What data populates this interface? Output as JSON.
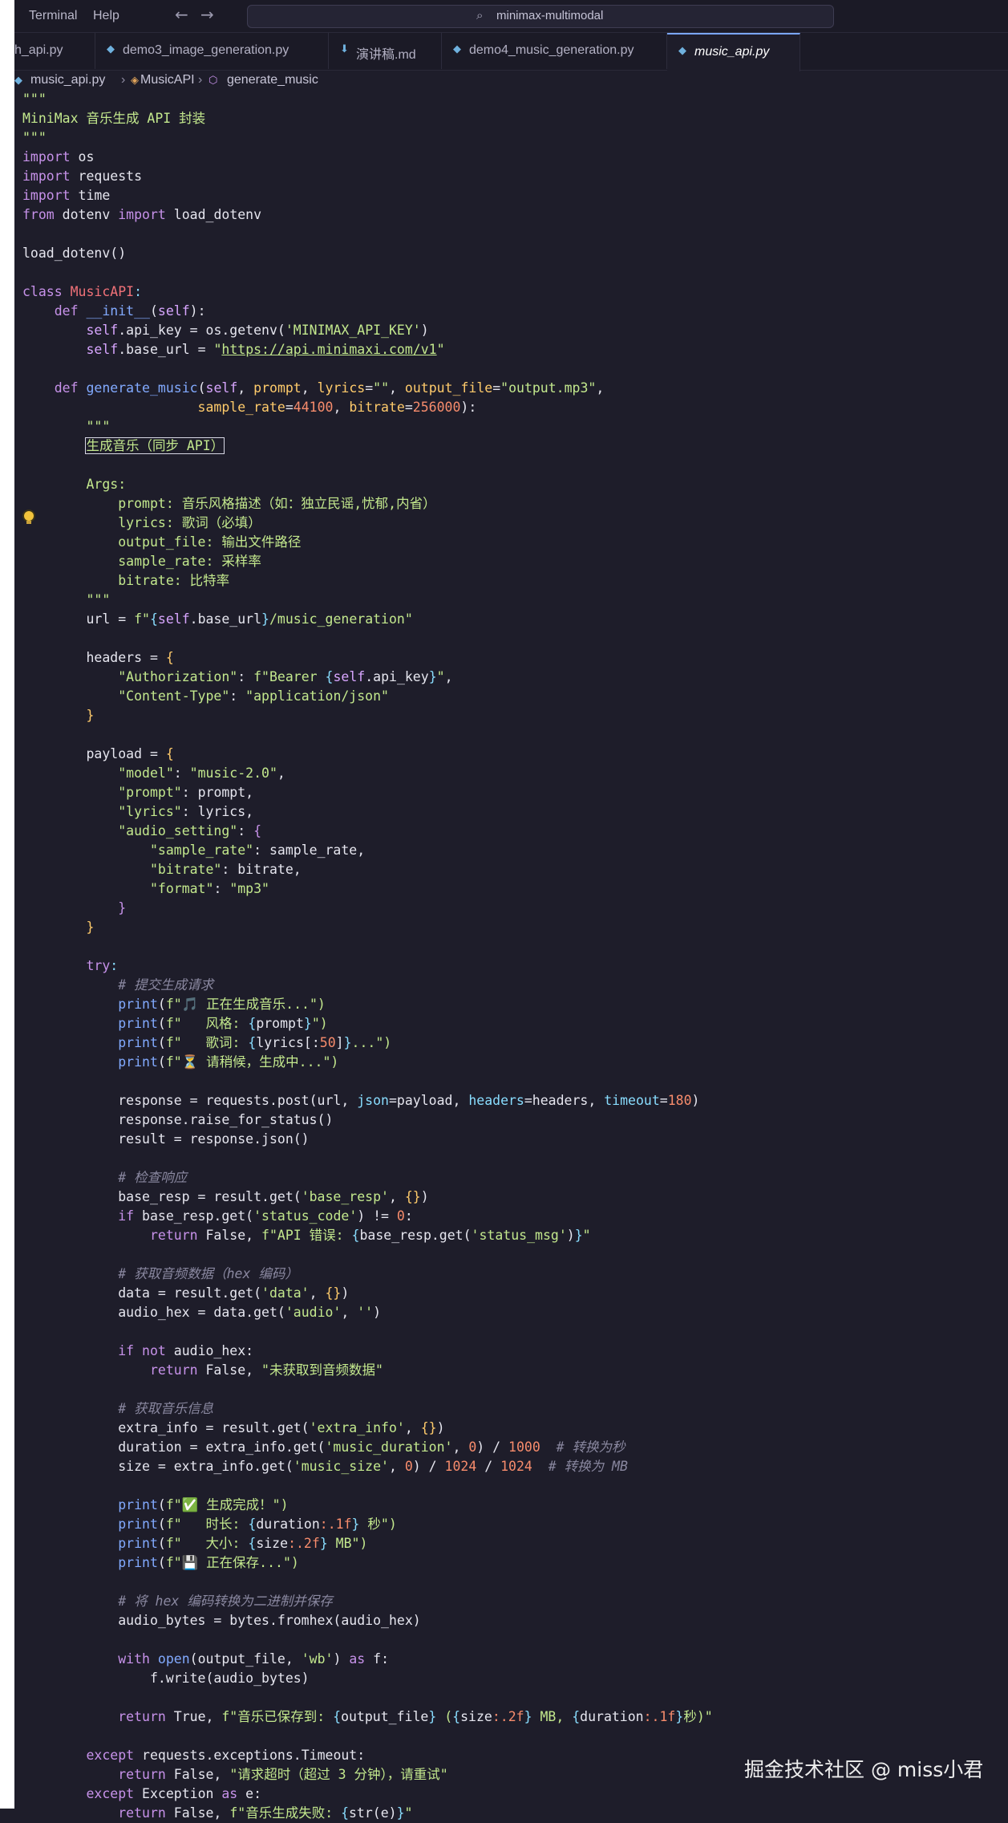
{
  "menu": {
    "terminal": "Terminal",
    "help": "Help",
    "back_icon": "←",
    "forward_icon": "→"
  },
  "search": {
    "icon": "⌕",
    "text": "minimax-multimodal"
  },
  "tabs": [
    {
      "label": "h_api.py",
      "icon": "python-icon"
    },
    {
      "label": "demo3_image_generation.py",
      "icon": "python-icon"
    },
    {
      "label": "演讲稿.md",
      "icon": "markdown-icon"
    },
    {
      "label": "demo4_music_generation.py",
      "icon": "python-icon"
    },
    {
      "label": "music_api.py",
      "icon": "python-icon",
      "active": true
    }
  ],
  "breadcrumb": {
    "file": "music_api.py",
    "class": "MusicAPI",
    "method": "generate_music",
    "sep": "›"
  },
  "code": {
    "doc_title": "MiniMax 音乐生成 API 封装",
    "api_key_env": "'MINIMAX_API_KEY'",
    "base_url": "https://api.minimaxi.com/v1",
    "docstring_title": "生成音乐（同步 API）",
    "args": {
      "prompt": "音乐风格描述（如：独立民谣,忧郁,内省）",
      "lyrics": "歌词（必填）",
      "output_file": "输出文件路径",
      "sample_rate": "采样率",
      "bitrate": "比特率"
    },
    "endpoint": "/music_generation\"",
    "model": "\"music-2.0\"",
    "comments": {
      "submit": "# 提交生成请求",
      "check": "# 检查响应",
      "fetch_audio": "# 获取音频数据（hex 编码）",
      "fetch_info": "# 获取音乐信息",
      "to_seconds": "# 转换为秒",
      "to_mb": "# 转换为 MB",
      "save": "# 将 hex 编码转换为二进制并保存"
    },
    "messages": {
      "generating": "🎵 正在生成音乐...\")",
      "style": "   风格: ",
      "lyrics": "   歌词: ",
      "wait": "⏳ 请稍候，生成中...\")",
      "api_error": "API 错误: ",
      "no_audio": "\"未获取到音频数据\"",
      "done": "✅ 生成完成！\")",
      "duration": "   时长: ",
      "seconds": " 秒\")",
      "size": "   大小: ",
      "saving": "💾 正在保存...\")",
      "saved": "音乐已保存到: ",
      "timeout": "\"请求超时（超过 3 分钟），请重试\"",
      "failed": "音乐生成失败: "
    }
  },
  "watermark": "掘金技术社区 @ miss小君"
}
